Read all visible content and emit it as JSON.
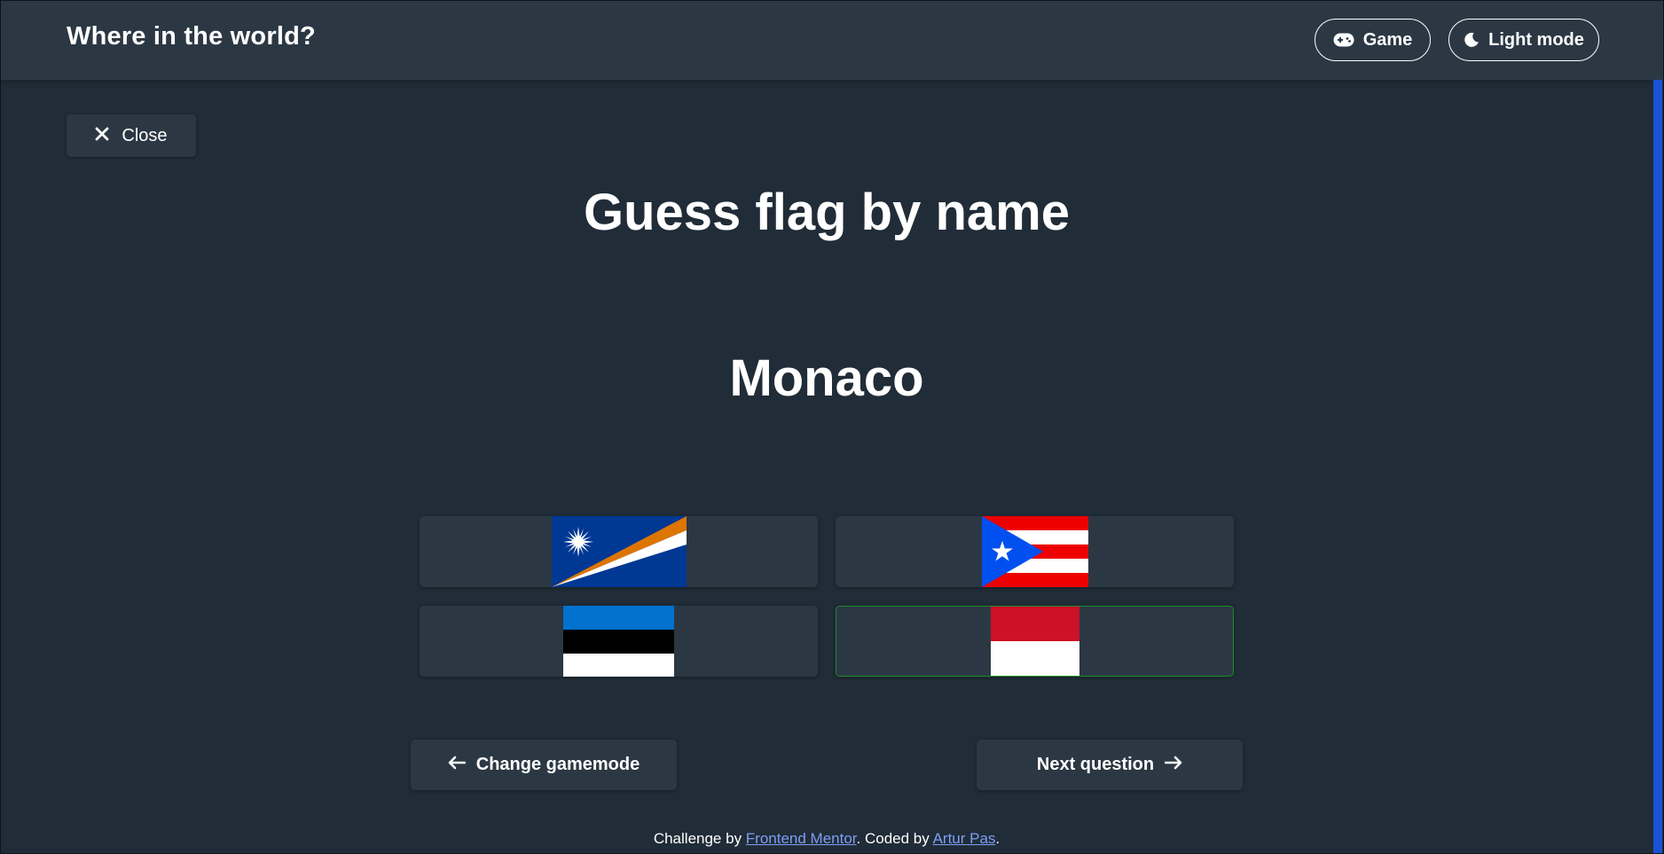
{
  "header": {
    "title": "Where in the world?",
    "game_label": "Game",
    "theme_label": "Light mode",
    "game_icon": "gamepad-icon",
    "theme_icon": "moon-icon"
  },
  "close": {
    "label": "Close",
    "icon": "close-icon"
  },
  "quiz": {
    "title": "Guess flag by name",
    "country": "Monaco",
    "options": [
      {
        "flag": "Marshall Islands",
        "state": "neutral"
      },
      {
        "flag": "Puerto Rico",
        "state": "neutral"
      },
      {
        "flag": "Estonia",
        "state": "neutral"
      },
      {
        "flag": "Monaco",
        "state": "correct"
      }
    ],
    "correct_border_color": "#1f8a2a"
  },
  "nav": {
    "back_label": "Change gamemode",
    "next_label": "Next question",
    "back_icon": "arrow-left-icon",
    "next_icon": "arrow-right-icon"
  },
  "footer": {
    "prefix": "Challenge by ",
    "link1": "Frontend Mentor",
    "middle": ". Coded by ",
    "link2": "Artur Pas",
    "suffix": "."
  },
  "colors": {
    "background": "#202c37",
    "element": "#2b3844",
    "text": "#ffffff",
    "link": "#7f9df5",
    "scrollbar": "#1a52d6"
  }
}
